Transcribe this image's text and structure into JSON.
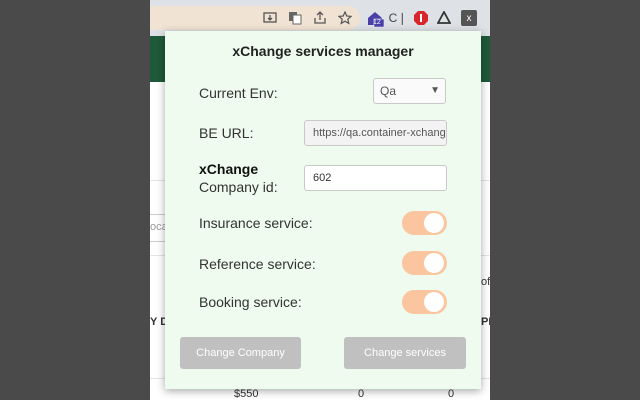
{
  "browser": {
    "profile_badge": "12",
    "extension_letter": "x",
    "ext_ci_label": "C❘",
    "bg_texts": [
      "oca",
      "Y DA",
      "of",
      "PE",
      "$550",
      "0",
      "0"
    ]
  },
  "popup": {
    "title": "xChange services manager",
    "env": {
      "label": "Current Env:",
      "value": "Qa"
    },
    "be_url": {
      "label": "BE URL:",
      "value": "https://qa.container-xchange"
    },
    "company": {
      "label_bold": "xChange",
      "label": "Company id:",
      "value": "602"
    },
    "services": [
      {
        "label": "Insurance service:",
        "on": true
      },
      {
        "label": "Reference service:",
        "on": true
      },
      {
        "label": "Booking service:",
        "on": true
      }
    ],
    "buttons": {
      "change_company": "Change Company",
      "change_services": "Change services"
    },
    "colors": {
      "background": "#eefbee",
      "toggle": "#fbc59f",
      "button": "#c0c0c0"
    }
  }
}
